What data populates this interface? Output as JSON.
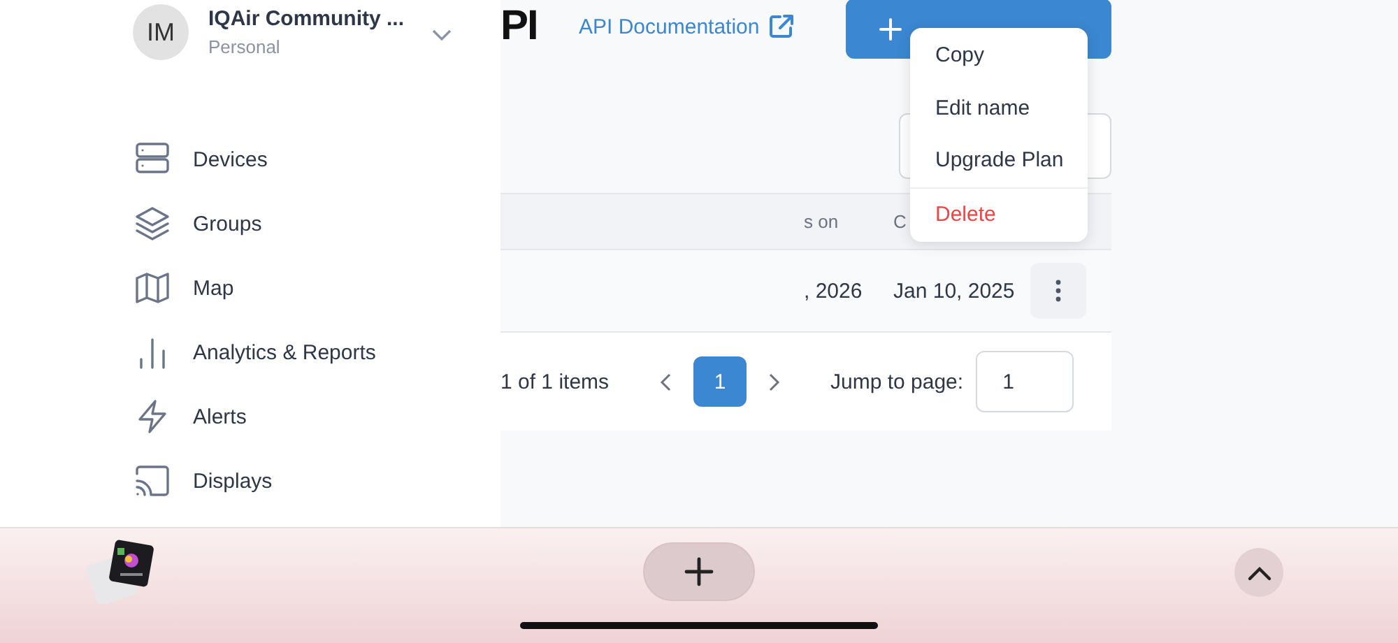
{
  "sidebar": {
    "account": {
      "initials": "IM",
      "name": "IQAir Community ...",
      "plan": "Personal"
    },
    "items": [
      {
        "label": "Devices",
        "kind": "devices"
      },
      {
        "label": "Groups",
        "kind": "groups"
      },
      {
        "label": "Map",
        "kind": "map"
      },
      {
        "label": "Analytics & Reports",
        "kind": "analytics"
      },
      {
        "label": "Alerts",
        "kind": "alerts"
      },
      {
        "label": "Displays",
        "kind": "displays"
      }
    ]
  },
  "header": {
    "title": "PI",
    "docs_link": "API Documentation"
  },
  "table": {
    "columns": [
      "s on",
      "C"
    ],
    "rows": [
      {
        "cells": [
          ", 2026",
          "Jan 10, 2025"
        ]
      }
    ]
  },
  "pagination": {
    "summary": "1 of 1 items",
    "pages": [
      {
        "label": "1",
        "selected": true
      }
    ],
    "jump_label": "Jump to page:",
    "jump_value": "1"
  },
  "menu": {
    "items": [
      {
        "label": "Copy",
        "kind": "normal"
      },
      {
        "label": "Edit name",
        "kind": "normal"
      },
      {
        "label": "Upgrade Plan",
        "kind": "normal"
      },
      {
        "label": "Delete",
        "kind": "danger"
      }
    ]
  }
}
